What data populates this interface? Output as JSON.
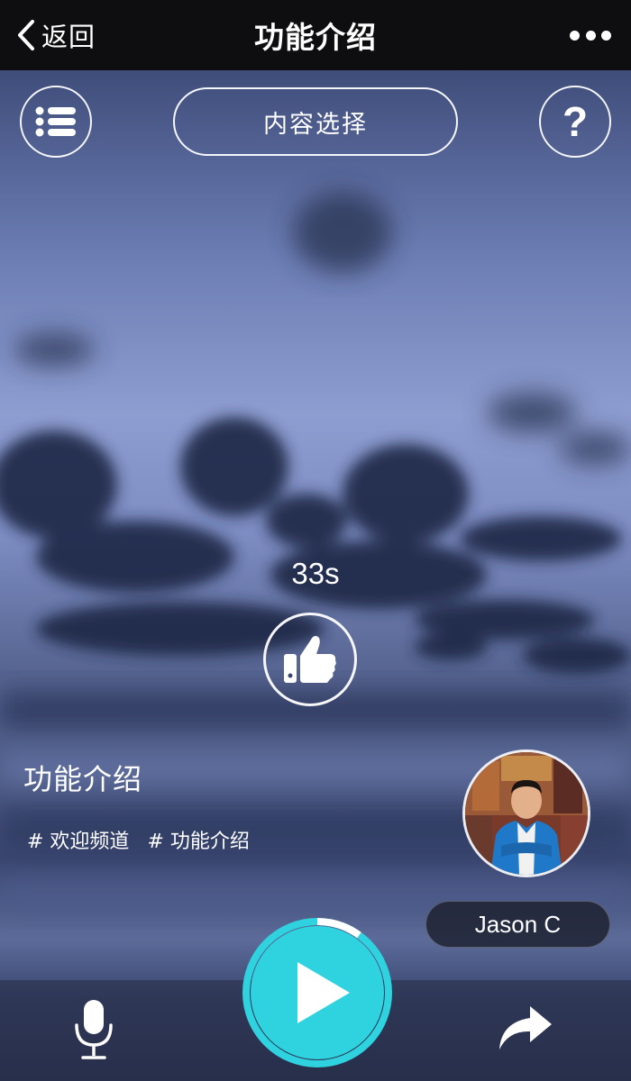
{
  "nav": {
    "back_label": "返回",
    "title": "功能介绍"
  },
  "controls": {
    "content_select_label": "内容选择",
    "help_symbol": "?"
  },
  "player": {
    "timer": "33s",
    "progress_fraction": 0.1
  },
  "post": {
    "title": "功能介绍",
    "tags": [
      "# 欢迎频道",
      "# 功能介绍"
    ]
  },
  "author": {
    "name": "Jason C"
  },
  "colors": {
    "accent": "#2fd3e0",
    "nav_bg": "#0e0e10",
    "sky_dark": "#2b3556",
    "sky_light": "#9aa9d4"
  },
  "icons": {
    "back": "chevron-left-icon",
    "more": "more-dots-icon",
    "menu": "list-icon",
    "help": "question-icon",
    "like": "thumbs-up-icon",
    "play": "play-icon",
    "mic": "microphone-icon",
    "share": "share-arrow-icon"
  }
}
